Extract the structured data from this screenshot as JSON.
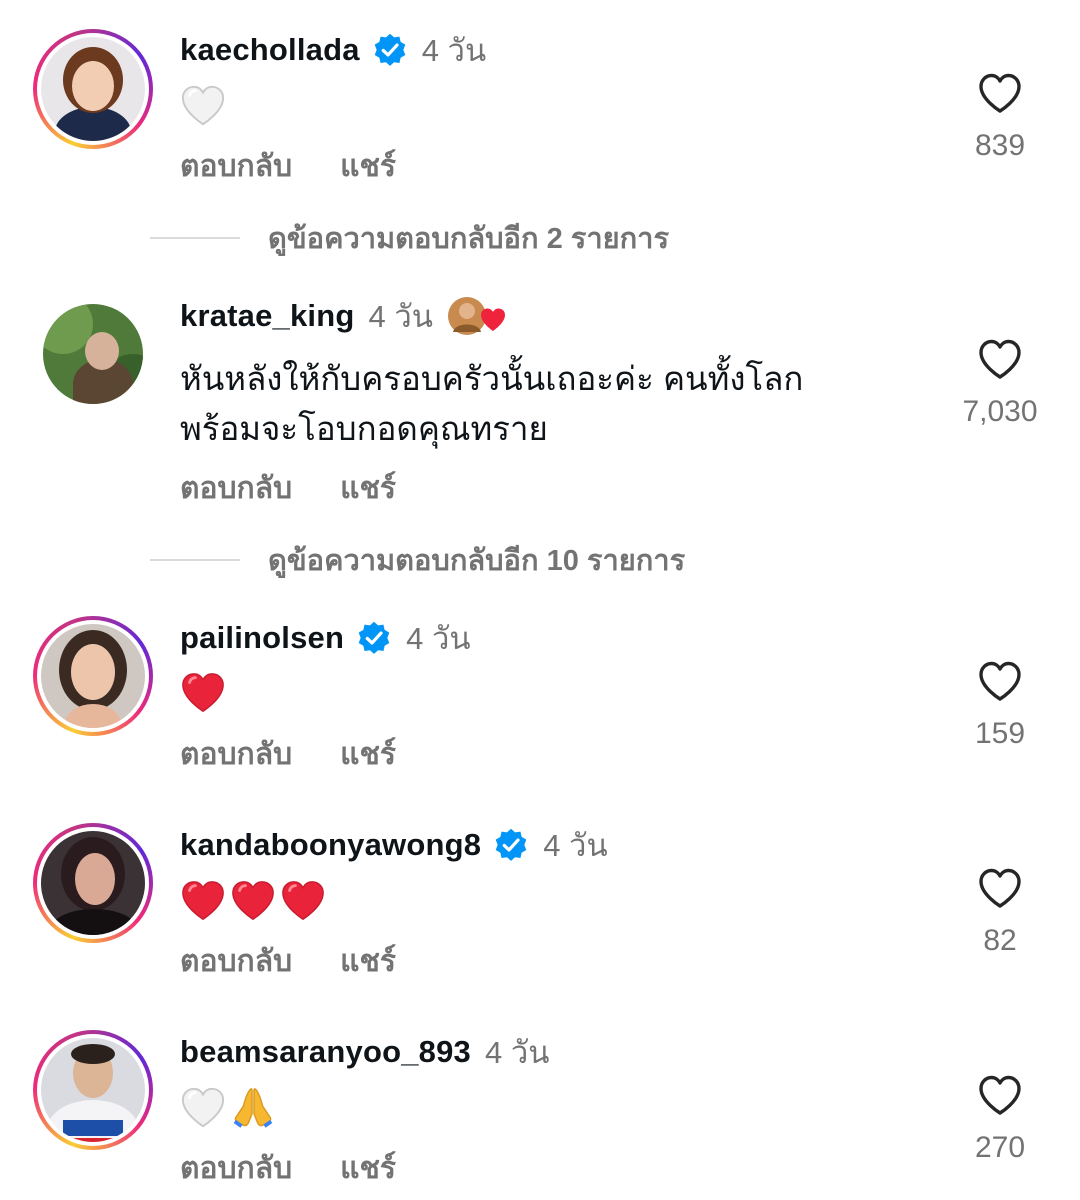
{
  "comments": [
    {
      "username": "kaechollada",
      "verified": true,
      "time": "4 วัน",
      "reactions": [
        "white-heart"
      ],
      "reply_label": "ตอบกลับ",
      "share_label": "แชร์",
      "likes": "839",
      "story_ring": true
    },
    {
      "username": "kratae_king",
      "verified": false,
      "time": "4 วัน",
      "text_lines": [
        "หันหลังให้กับครอบครัวนั้นเถอะค่ะ คนทั้งโลก",
        "พร้อมจะโอบกอดคุณทราย"
      ],
      "reply_label": "ตอบกลับ",
      "share_label": "แชร์",
      "likes": "7,030",
      "story_ring": false
    },
    {
      "username": "pailinolsen",
      "verified": true,
      "time": "4 วัน",
      "reactions": [
        "red-heart"
      ],
      "reply_label": "ตอบกลับ",
      "share_label": "แชร์",
      "likes": "159",
      "story_ring": true
    },
    {
      "username": "kandaboonyawong8",
      "verified": true,
      "time": "4 วัน",
      "reactions": [
        "red-heart",
        "red-heart",
        "red-heart"
      ],
      "reply_label": "ตอบกลับ",
      "share_label": "แชร์",
      "likes": "82",
      "story_ring": true
    },
    {
      "username": "beamsaranyoo_893",
      "verified": false,
      "time": "4 วัน",
      "reactions": [
        "white-heart",
        "folded-hands"
      ],
      "reply_label": "ตอบกลับ",
      "share_label": "แชร์",
      "likes": "270",
      "story_ring": true
    }
  ],
  "view_replies": [
    "ดูข้อความตอบกลับอีก 2 รายการ",
    "ดูข้อความตอบกลับอีก 10 รายการ"
  ],
  "colors": {
    "verified": "#0095f6",
    "muted": "#737373",
    "heart_red": "#e0245e"
  }
}
